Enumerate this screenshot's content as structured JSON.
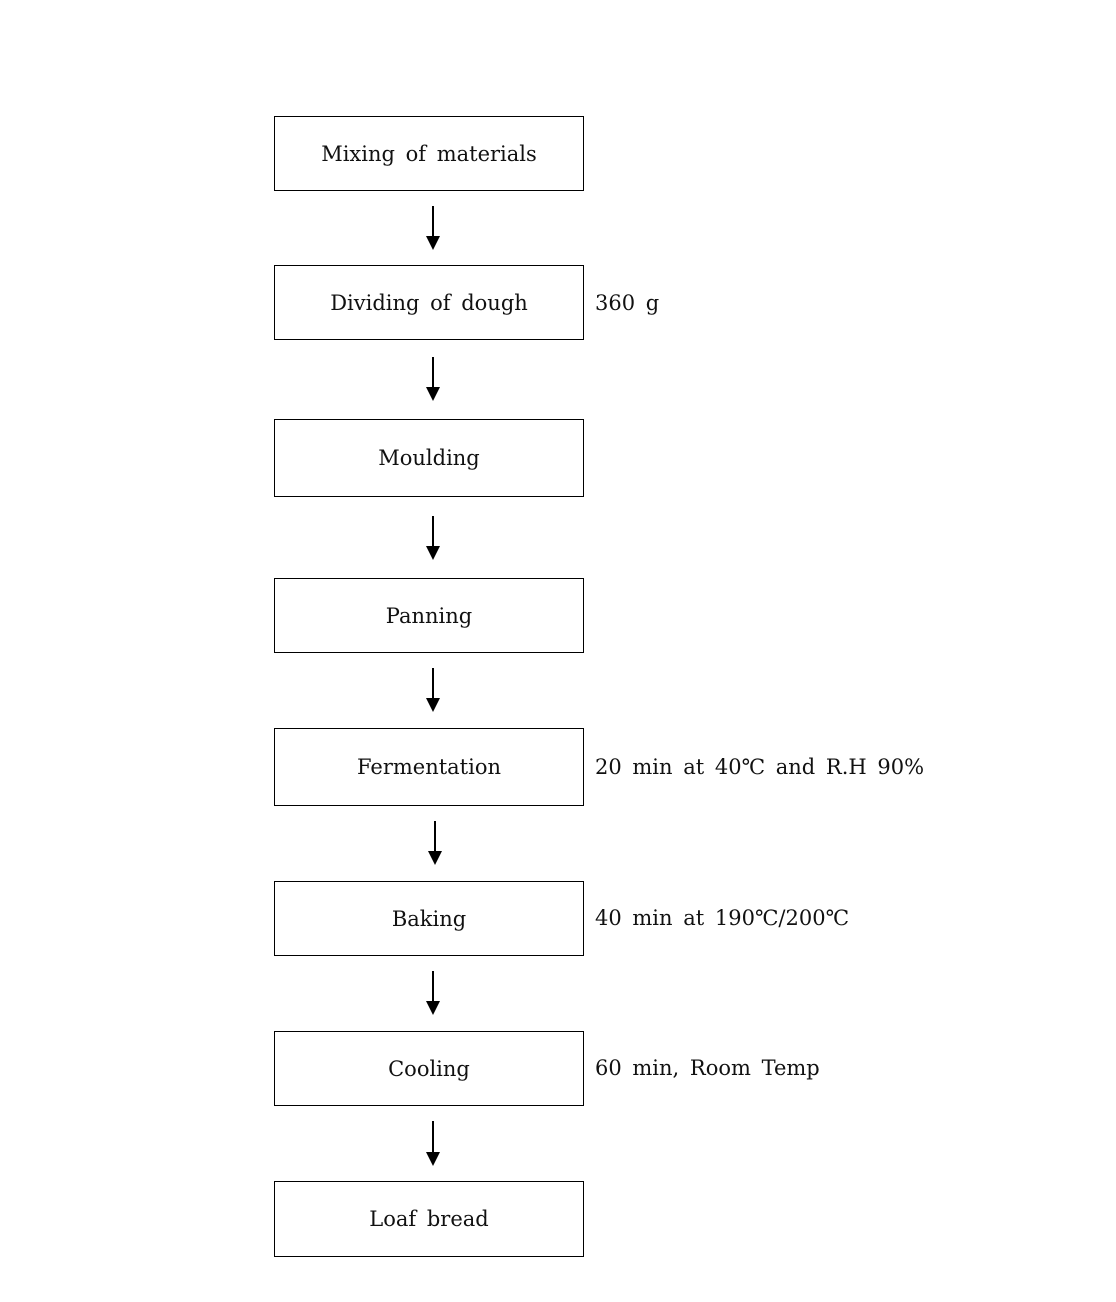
{
  "steps": [
    {
      "label": "Mixing of materials",
      "note": ""
    },
    {
      "label": "Dividing of dough",
      "note": "360 g"
    },
    {
      "label": "Moulding",
      "note": ""
    },
    {
      "label": "Panning",
      "note": ""
    },
    {
      "label": "Fermentation",
      "note": "20 min at 40℃ and R.H 90%"
    },
    {
      "label": "Baking",
      "note": "40 min at 190℃/200℃"
    },
    {
      "label": "Cooling",
      "note": "60 min, Room Temp"
    },
    {
      "label": "Loaf bread",
      "note": ""
    }
  ]
}
